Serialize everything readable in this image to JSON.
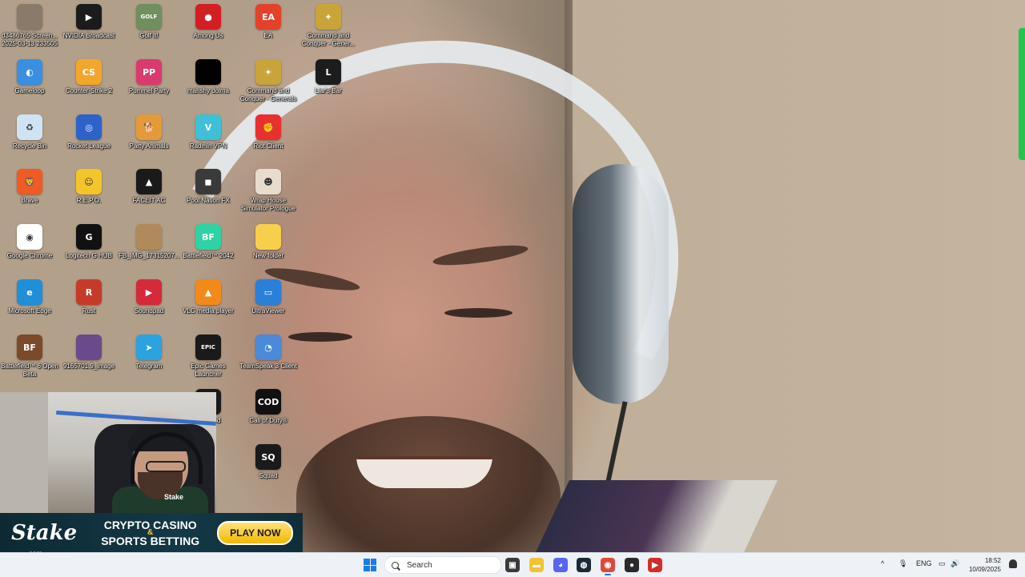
{
  "desktop_icons": [
    {
      "label": "d3486765 Screen... 2025-03-13 233505",
      "icon": "screenshot-thumbnail",
      "color": "#8a7a6a",
      "glyph": "",
      "col": 0,
      "row": 0
    },
    {
      "label": "NVIDIA Broadcast",
      "icon": "nvidia-broadcast-icon",
      "color": "#1b1b1b",
      "glyph": "▶",
      "col": 1,
      "row": 0
    },
    {
      "label": "Golf It!",
      "icon": "golf-it-icon",
      "color": "#6f8f5f",
      "glyph": "GOLF",
      "col": 2,
      "row": 0
    },
    {
      "label": "Among Us",
      "icon": "among-us-icon",
      "color": "#d11f24",
      "glyph": "●",
      "col": 3,
      "row": 0
    },
    {
      "label": "EA",
      "icon": "ea-icon",
      "color": "#e4412a",
      "glyph": "EA",
      "col": 4,
      "row": 0
    },
    {
      "label": "Command and Conquer - Gener...",
      "icon": "command-conquer-icon",
      "color": "#c8a43a",
      "glyph": "✦",
      "col": 5,
      "row": 0
    },
    {
      "label": "Gameloop",
      "icon": "gameloop-icon",
      "color": "#3a8fe0",
      "glyph": "◐",
      "col": 0,
      "row": 1
    },
    {
      "label": "Counter-Strike 2",
      "icon": "counter-strike-icon",
      "color": "#f2a72c",
      "glyph": "CS",
      "col": 1,
      "row": 1
    },
    {
      "label": "Pummel Party",
      "icon": "pummel-party-icon",
      "color": "#d93b6e",
      "glyph": "PP",
      "col": 2,
      "row": 1
    },
    {
      "label": "mahshy dolma",
      "icon": "black-file-icon",
      "color": "#000000",
      "glyph": "",
      "col": 3,
      "row": 1
    },
    {
      "label": "Command and Conquer - Generals",
      "icon": "command-conquer-generals-icon",
      "color": "#c8a43a",
      "glyph": "✦",
      "col": 4,
      "row": 1
    },
    {
      "label": "Liar's Bar",
      "icon": "liars-bar-icon",
      "color": "#1c1c1c",
      "glyph": "L",
      "col": 5,
      "row": 1
    },
    {
      "label": "Recycle Bin",
      "icon": "recycle-bin-icon",
      "color": "#cfe3f5",
      "glyph": "♻",
      "col": 0,
      "row": 2
    },
    {
      "label": "Rocket League",
      "icon": "rocket-league-icon",
      "color": "#2d63c8",
      "glyph": "◎",
      "col": 1,
      "row": 2
    },
    {
      "label": "Party Animals",
      "icon": "party-animals-icon",
      "color": "#e49a3a",
      "glyph": "🐕",
      "col": 2,
      "row": 2
    },
    {
      "label": "Radmin VPN",
      "icon": "radmin-vpn-icon",
      "color": "#3fc0d8",
      "glyph": "V",
      "col": 3,
      "row": 2
    },
    {
      "label": "Riot Client",
      "icon": "riot-client-icon",
      "color": "#e8302f",
      "glyph": "✊",
      "col": 4,
      "row": 2
    },
    {
      "label": "Brave",
      "icon": "brave-icon",
      "color": "#f05a26",
      "glyph": "🦁",
      "col": 0,
      "row": 3
    },
    {
      "label": "R.E.P.O.",
      "icon": "repo-icon",
      "color": "#f3c52b",
      "glyph": "☺",
      "col": 1,
      "row": 3
    },
    {
      "label": "FACEIT AC",
      "icon": "faceit-ac-icon",
      "color": "#1a1a1a",
      "glyph": "▲",
      "col": 2,
      "row": 3
    },
    {
      "label": "Pool Nation FX",
      "icon": "pool-nation-icon",
      "color": "#3a3a3a",
      "glyph": "◼",
      "col": 3,
      "row": 3
    },
    {
      "label": "Wrap House Simulator Prologue",
      "icon": "wrap-house-icon",
      "color": "#e8dccf",
      "glyph": "☻",
      "col": 4,
      "row": 3
    },
    {
      "label": "Google Chrome",
      "icon": "google-chrome-icon",
      "color": "#ffffff",
      "glyph": "◉",
      "col": 0,
      "row": 4
    },
    {
      "label": "Logitech G HUB",
      "icon": "logitech-ghub-icon",
      "color": "#111111",
      "glyph": "G",
      "col": 1,
      "row": 4
    },
    {
      "label": "FB_IMG_17315207...",
      "icon": "image-file-icon",
      "color": "#b08a5a",
      "glyph": "",
      "col": 2,
      "row": 4
    },
    {
      "label": "Battlefield™ 2042",
      "icon": "battlefield-2042-icon",
      "color": "#2dd3a4",
      "glyph": "BF",
      "col": 3,
      "row": 4
    },
    {
      "label": "New folder",
      "icon": "folder-icon",
      "color": "#f7cf4a",
      "glyph": "",
      "col": 4,
      "row": 4
    },
    {
      "label": "Microsoft Edge",
      "icon": "microsoft-edge-icon",
      "color": "#1e8fd8",
      "glyph": "e",
      "col": 0,
      "row": 5
    },
    {
      "label": "Rust",
      "icon": "rust-icon",
      "color": "#c63a2a",
      "glyph": "R",
      "col": 1,
      "row": 5
    },
    {
      "label": "Soundpad",
      "icon": "soundpad-icon",
      "color": "#d42a3a",
      "glyph": "▶",
      "col": 2,
      "row": 5
    },
    {
      "label": "VLC media player",
      "icon": "vlc-icon",
      "color": "#f28a1a",
      "glyph": "▲",
      "col": 3,
      "row": 5
    },
    {
      "label": "UltraViewer",
      "icon": "ultraviewer-icon",
      "color": "#2a7fd8",
      "glyph": "▭",
      "col": 4,
      "row": 5
    },
    {
      "label": "Battlefield™ 6 Open Beta",
      "icon": "battlefield-6-icon",
      "color": "#7a4a2a",
      "glyph": "BF",
      "col": 0,
      "row": 6
    },
    {
      "label": "9165701.9_image",
      "icon": "image-file-icon",
      "color": "#6a4a8a",
      "glyph": "",
      "col": 1,
      "row": 6
    },
    {
      "label": "Telegram",
      "icon": "telegram-icon",
      "color": "#2aa3e0",
      "glyph": "➤",
      "col": 2,
      "row": 6
    },
    {
      "label": "Epic Games Launcher",
      "icon": "epic-games-icon",
      "color": "#1a1a1a",
      "glyph": "EPIC",
      "col": 3,
      "row": 6
    },
    {
      "label": "TeamSpeak 3 Client",
      "icon": "teamspeak-icon",
      "color": "#4a8ad8",
      "glyph": "◔",
      "col": 4,
      "row": 6
    },
    {
      "label": "Playland",
      "icon": "playland-icon",
      "color": "#1a1a1a",
      "glyph": "",
      "col": 3,
      "row": 7
    },
    {
      "label": "Call of Duty®",
      "icon": "call-of-duty-icon",
      "color": "#111111",
      "glyph": "COD",
      "col": 4,
      "row": 7
    },
    {
      "label": "Squad",
      "icon": "squad-icon",
      "color": "#1a1a1a",
      "glyph": "SQ",
      "col": 4,
      "row": 8
    }
  ],
  "banner": {
    "logo": "Stake",
    "logo_sub": ".com",
    "line1": "CRYPTO CASINO",
    "amp": "&",
    "line2": "SPORTS BETTING",
    "cta": "PLAY NOW"
  },
  "webcam": {
    "shirt_logo": "Stake"
  },
  "taskbar": {
    "search_placeholder": "Search",
    "apps": [
      {
        "name": "task-view-icon",
        "color": "#3a3a3a",
        "glyph": "▣"
      },
      {
        "name": "file-explorer-icon",
        "color": "#f2c234",
        "glyph": "▬"
      },
      {
        "name": "discord-icon",
        "color": "#5865f2",
        "glyph": "◕"
      },
      {
        "name": "steam-icon",
        "color": "#1b2838",
        "glyph": "◍"
      },
      {
        "name": "chrome-icon",
        "color": "#dd4b3b",
        "glyph": "◉"
      },
      {
        "name": "obs-icon",
        "color": "#2a2a2a",
        "glyph": "●"
      },
      {
        "name": "media-app-icon",
        "color": "#d0302a",
        "glyph": "▶"
      }
    ],
    "tray": {
      "language": "ENG",
      "time": "18:52",
      "date": "10/09/2025"
    }
  }
}
